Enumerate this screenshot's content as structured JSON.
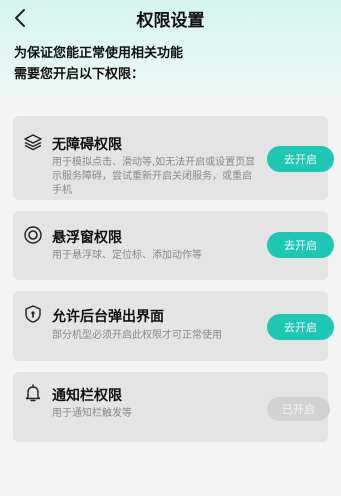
{
  "header": {
    "title": "权限设置",
    "intro_line1": "为保证您能正常使用相关功能",
    "intro_line2": "需要您开启以下权限："
  },
  "permissions": [
    {
      "icon": "layers-icon",
      "name": "无障碍权限",
      "desc": "用于模拟点击、滑动等,如无法开启或设置页显示服务障碍，尝试重新开启关闭服务，或重启手机",
      "button": "去开启"
    },
    {
      "icon": "floating-window-icon",
      "name": "悬浮窗权限",
      "desc": "用于悬浮球、定位标、添加动作等",
      "button": "去开启"
    },
    {
      "icon": "shield-icon",
      "name": "允许后台弹出界面",
      "desc": "部分机型必须开启此权限才可正常使用",
      "button": "去开启"
    },
    {
      "icon": "bell-icon",
      "name": "通知栏权限",
      "desc": "用于通知栏触发等",
      "button": "已开启"
    }
  ],
  "colors": {
    "accent": "#1ec7b4",
    "card_bg": "#e4e4e4",
    "disabled": "#d2d2d2"
  }
}
